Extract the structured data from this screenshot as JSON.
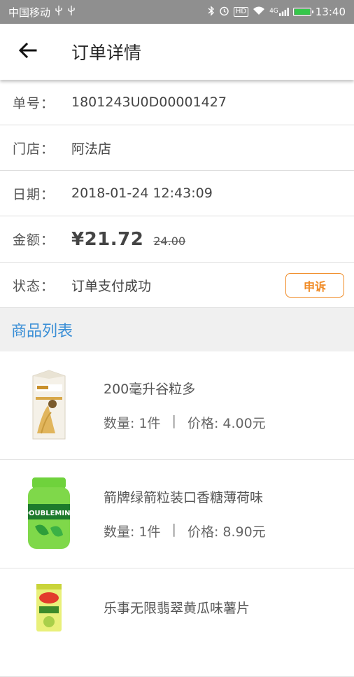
{
  "status_bar": {
    "carrier": "中国移动",
    "usb_icons": [
      "usb-icon",
      "usb-icon"
    ],
    "right_icons": [
      "bluetooth-icon",
      "alarm-icon",
      "hd-icon",
      "wifi-icon",
      "signal-4g-icon",
      "battery-icon"
    ],
    "hd": "HD",
    "net": "4G",
    "time": "13:40"
  },
  "header": {
    "back_icon": "arrow-left-icon",
    "title": "订单详情"
  },
  "order": {
    "number_label": "单号：",
    "number": "1801243U0D00001427",
    "store_label": "门店：",
    "store": "阿法店",
    "date_label": "日期：",
    "date": "2018-01-24 12:43:09",
    "amount_label": "金额：",
    "amount": "¥21.72",
    "original_amount": "24.00",
    "status_label": "状态：",
    "status": "订单支付成功",
    "complain_label": "申诉"
  },
  "products_section": {
    "title": "商品列表"
  },
  "products": [
    {
      "name": "200毫升谷粒多",
      "qty": "数量: 1件",
      "sep": "|",
      "price": "价格: 4.00元",
      "image": "milk-carton-image"
    },
    {
      "name": "箭牌绿箭粒装口香糖薄荷味",
      "qty": "数量: 1件",
      "sep": "|",
      "price": "价格: 8.90元",
      "image": "gum-bottle-image",
      "brand_text": "DOUBLEMINT"
    },
    {
      "name": "乐事无限翡翠黄瓜味薯片",
      "qty": "",
      "sep": "",
      "price": "",
      "image": "chips-can-image"
    }
  ],
  "colors": {
    "status_bar_bg": "#8f8f8f",
    "accent_blue": "#3b8fd6",
    "complain_orange": "#f08a24",
    "section_bg": "#f0f0f0"
  }
}
